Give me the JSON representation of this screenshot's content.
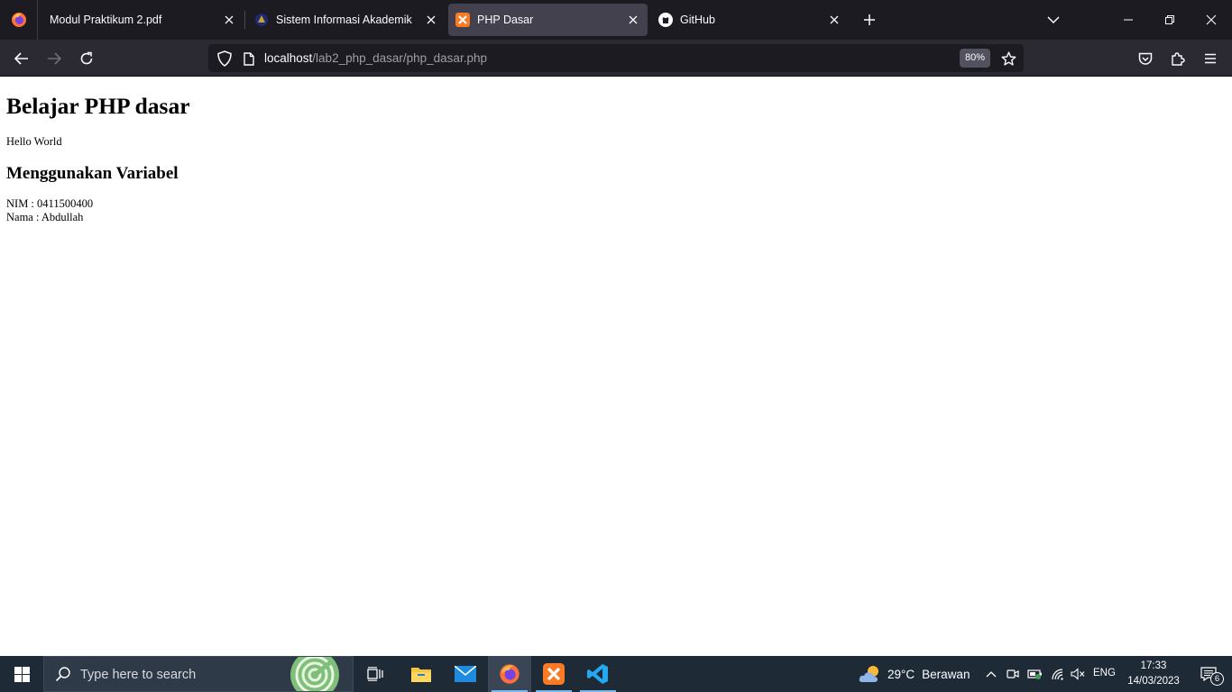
{
  "browser": {
    "tabs": [
      {
        "title": "Modul Praktikum 2.pdf",
        "icon": "pdf-icon",
        "active": false
      },
      {
        "title": "Sistem Informasi Akademik",
        "icon": "university-logo-icon",
        "active": false
      },
      {
        "title": "PHP Dasar",
        "icon": "xampp-icon",
        "active": true
      },
      {
        "title": "GitHub",
        "icon": "github-icon",
        "active": false
      }
    ],
    "url": {
      "host": "localhost",
      "path": "/lab2_php_dasar/php_dasar.php"
    },
    "zoom": "80%"
  },
  "page": {
    "heading": "Belajar PHP dasar",
    "greeting": "Hello World",
    "subheading": "Menggunakan Variabel",
    "nim_line": "NIM : 0411500400",
    "nama_line": "Nama : Abdullah"
  },
  "taskbar": {
    "search_placeholder": "Type here to search",
    "weather": {
      "temperature": "29°C",
      "condition": "Berawan"
    },
    "language": "ENG",
    "time": "17:33",
    "date": "14/03/2023",
    "notification_count": "6"
  },
  "colors": {
    "tabstrip_bg": "#1c1b22",
    "active_tab_bg": "#42414d",
    "toolbar_bg": "#2b2a33",
    "taskbar_bg": "#1f2a37",
    "accent": "#76b9ed"
  }
}
